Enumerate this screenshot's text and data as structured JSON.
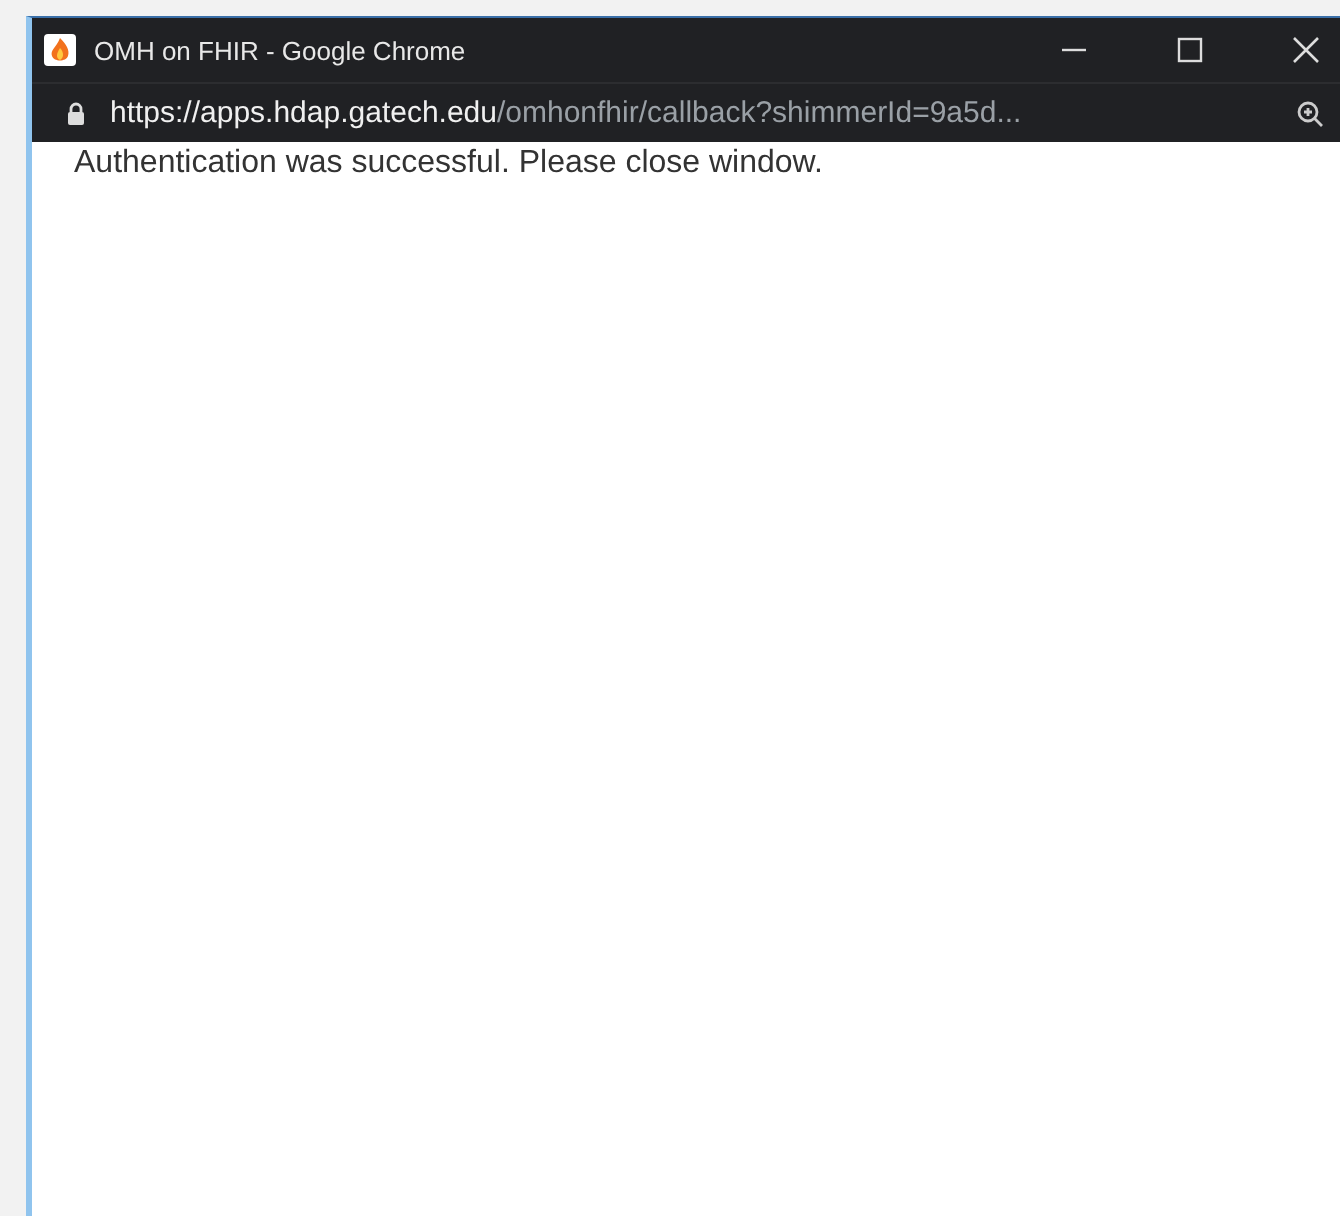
{
  "window": {
    "title": "OMH on FHIR - Google Chrome"
  },
  "address_bar": {
    "secure": true,
    "host": "https://apps.hdap.gatech.edu",
    "path": "/omhonfhir/callback?shimmerId=9a5d..."
  },
  "content": {
    "message": "Authentication was successful. Please close window."
  }
}
